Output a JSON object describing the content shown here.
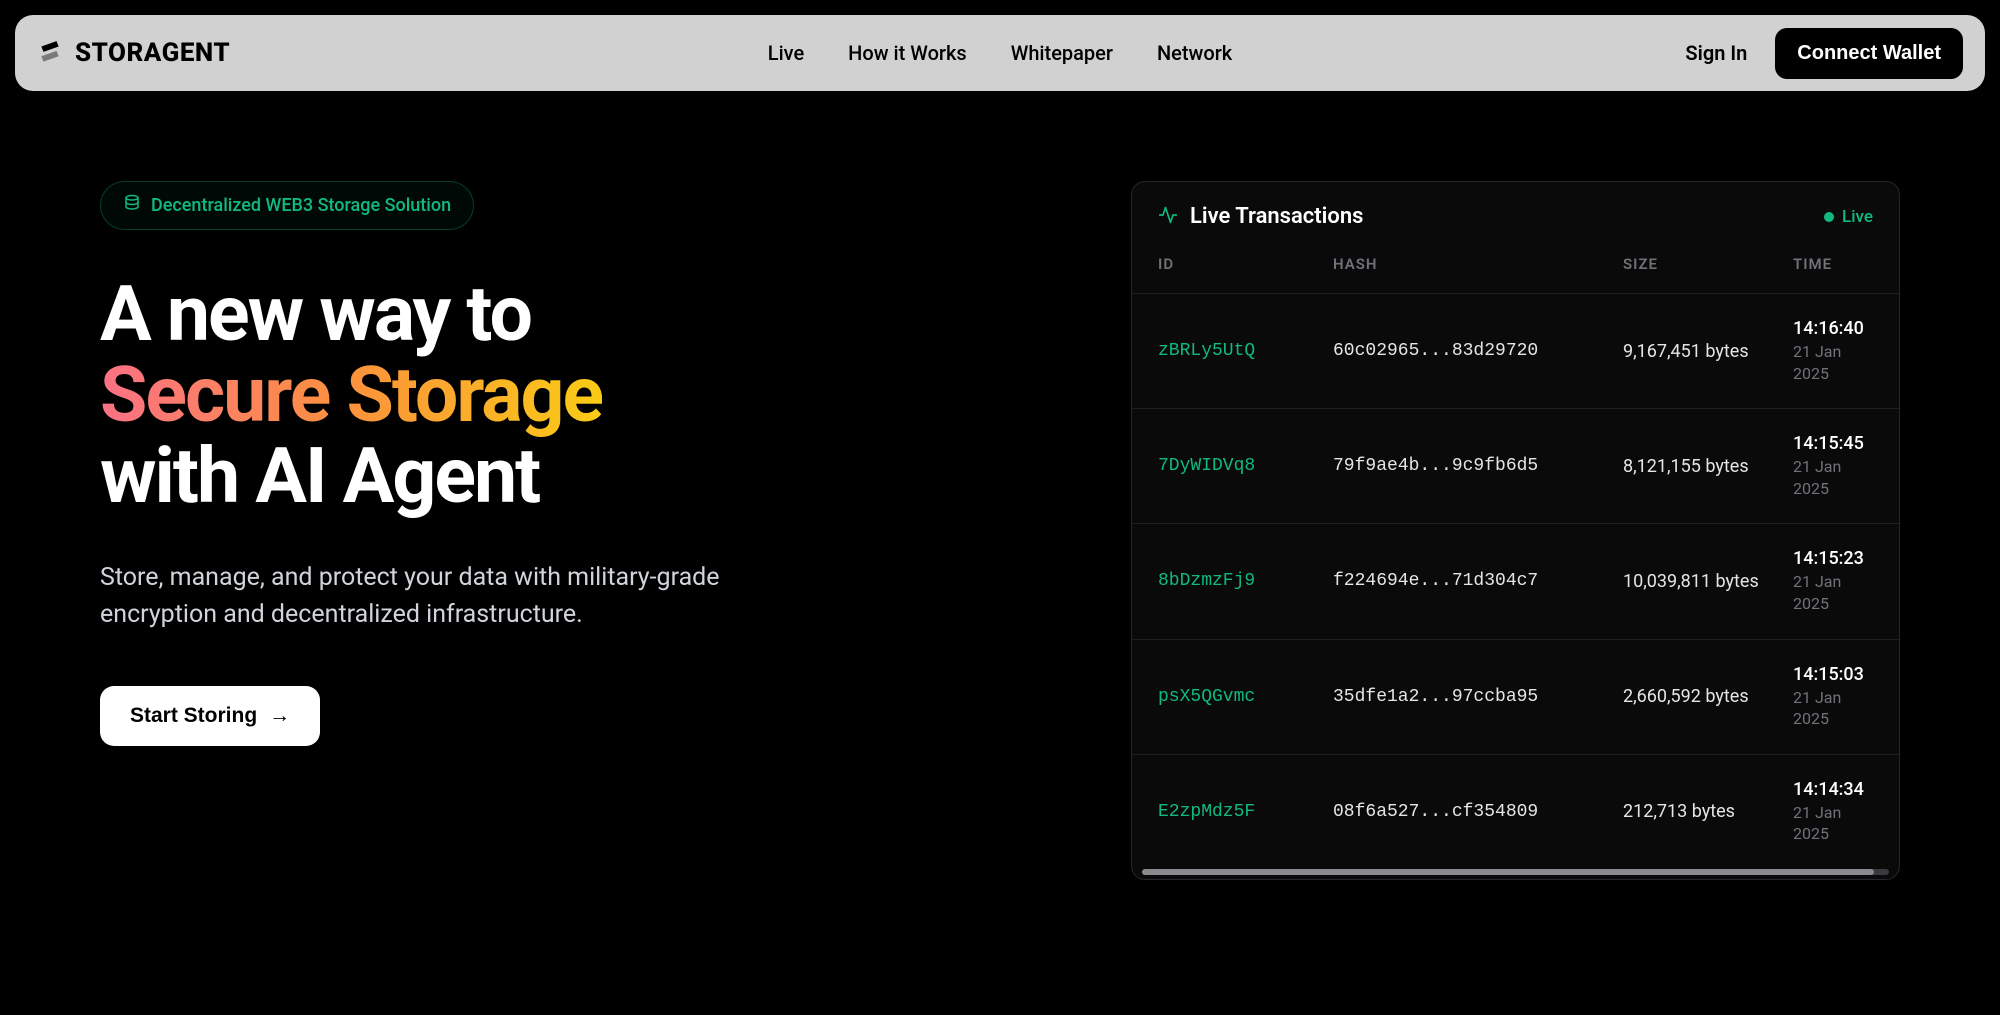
{
  "brand": {
    "name": "STORAGENT"
  },
  "nav": {
    "live": "Live",
    "how": "How it Works",
    "whitepaper": "Whitepaper",
    "network": "Network"
  },
  "header": {
    "signin": "Sign In",
    "connect": "Connect Wallet"
  },
  "hero": {
    "pill": "Decentralized WEB3 Storage Solution",
    "line1": "A new way to",
    "line2": "Secure Storage",
    "line3": "with AI Agent",
    "subtext": "Store, manage, and protect your data with military-grade encryption and decentralized infrastructure.",
    "cta": "Start Storing"
  },
  "panel": {
    "title": "Live Transactions",
    "badge": "Live",
    "columns": {
      "id": "ID",
      "hash": "HASH",
      "size": "SIZE",
      "time": "TIME"
    },
    "rows": [
      {
        "id": "zBRLy5UtQ",
        "hash": "60c02965...83d29720",
        "size": "9,167,451 bytes",
        "time": "14:16:40",
        "date": "21 Jan 2025"
      },
      {
        "id": "7DyWIDVq8",
        "hash": "79f9ae4b...9c9fb6d5",
        "size": "8,121,155 bytes",
        "time": "14:15:45",
        "date": "21 Jan 2025"
      },
      {
        "id": "8bDzmzFj9",
        "hash": "f224694e...71d304c7",
        "size": "10,039,811 bytes",
        "time": "14:15:23",
        "date": "21 Jan 2025"
      },
      {
        "id": "psX5QGvmc",
        "hash": "35dfe1a2...97ccba95",
        "size": "2,660,592 bytes",
        "time": "14:15:03",
        "date": "21 Jan 2025"
      },
      {
        "id": "E2zpMdz5F",
        "hash": "08f6a527...cf354809",
        "size": "212,713 bytes",
        "time": "14:14:34",
        "date": "21 Jan 2025"
      }
    ]
  }
}
